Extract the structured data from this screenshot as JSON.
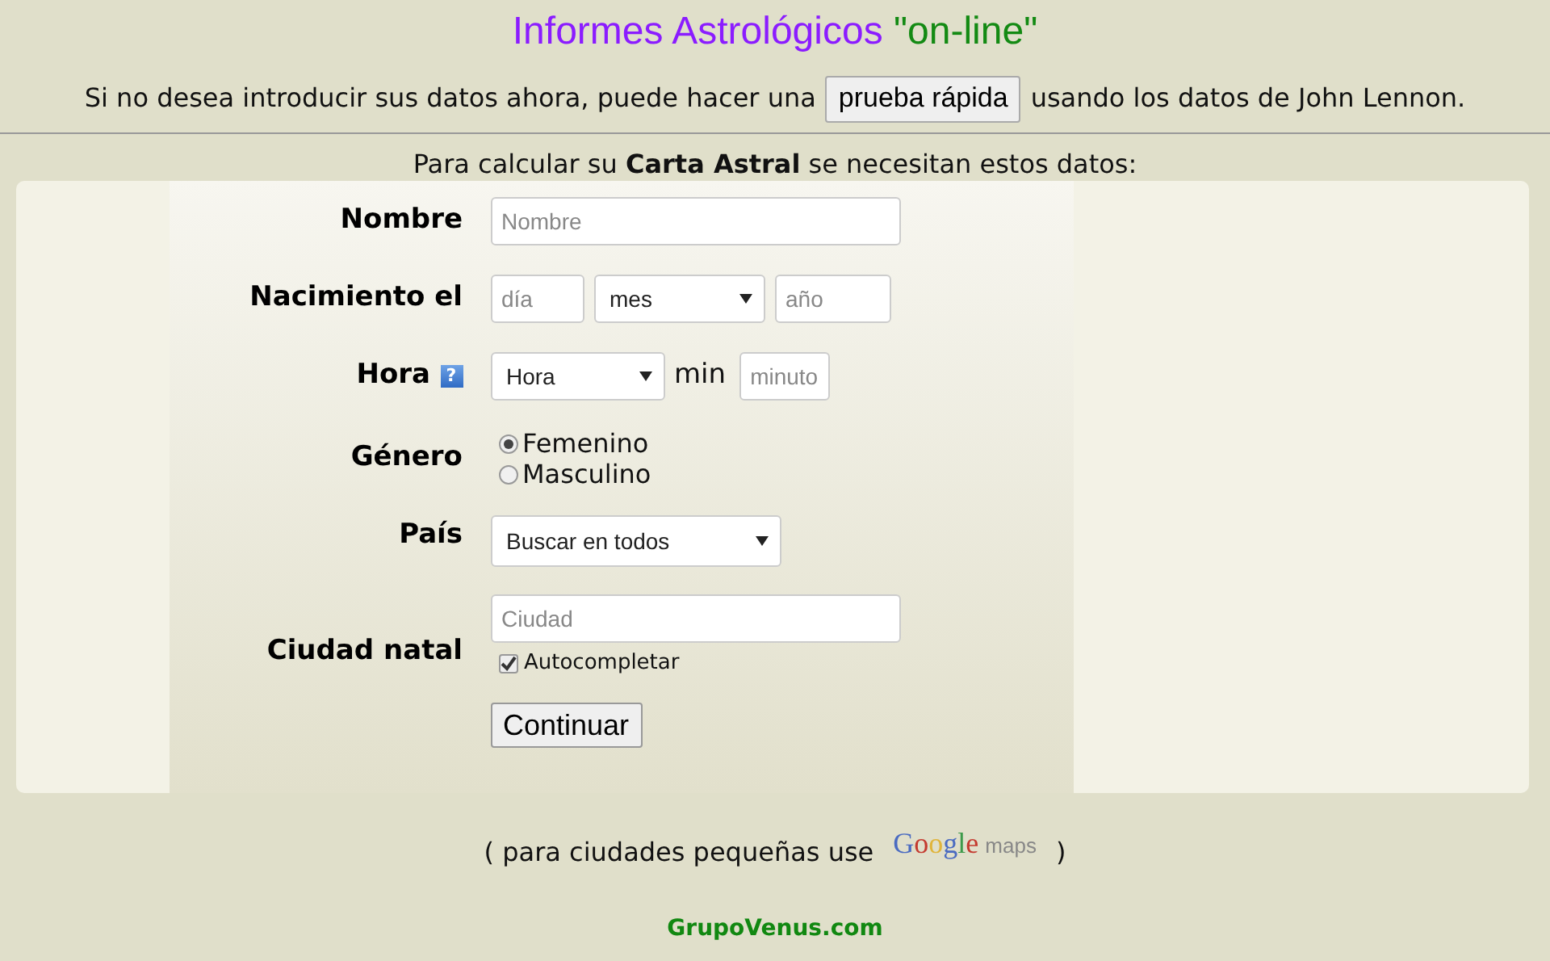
{
  "title": {
    "main": "Informes Astrológicos",
    "quoted": "\"on-line\""
  },
  "quick_test": {
    "before": "Si no desea introducir sus datos ahora, puede hacer una",
    "button": "prueba rápida",
    "after": "usando los datos de John Lennon."
  },
  "intro": "Para calcular su **Carta Astral** se necesitan estos datos:",
  "form": {
    "name": {
      "label": "Nombre",
      "placeholder": "Nombre"
    },
    "birth": {
      "label": "Nacimiento el",
      "day_placeholder": "día",
      "month_select": "mes",
      "year_placeholder": "año"
    },
    "time": {
      "label": "Hora",
      "help": "?",
      "hour_select": "Hora",
      "min_label": "min",
      "minute_placeholder": "minuto"
    },
    "gender": {
      "label": "Género",
      "options": [
        {
          "label": "Femenino",
          "selected": true
        },
        {
          "label": "Masculino",
          "selected": false
        }
      ]
    },
    "country": {
      "label": "País",
      "select": "Buscar en todos"
    },
    "city": {
      "label": "Ciudad natal",
      "placeholder": "Ciudad",
      "autocomplete": {
        "label": "Autocompletar",
        "checked": true
      }
    },
    "submit": "Continuar"
  },
  "footer_note": {
    "before": "( para ciudades pequeñas use",
    "logo_main": "Google",
    "logo_suffix": "maps",
    "after": ")"
  },
  "site": "GrupoVenus.com"
}
